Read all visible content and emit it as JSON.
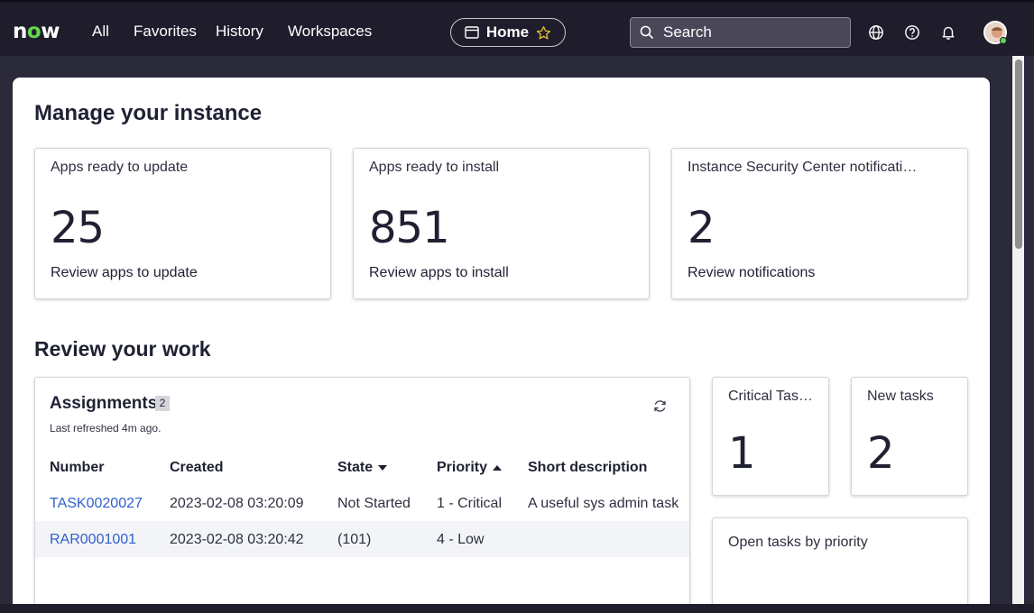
{
  "header": {
    "logo_text_n": "n",
    "logo_text_o": "o",
    "logo_text_w": "w",
    "nav": [
      "All",
      "Favorites",
      "History",
      "Workspaces"
    ],
    "home_label": "Home",
    "search_placeholder": "Search"
  },
  "page": {
    "section1_title": "Manage your instance",
    "section2_title": "Review your work"
  },
  "instance_cards": [
    {
      "title": "Apps ready to update",
      "value": "25",
      "link": "Review apps to update"
    },
    {
      "title": "Apps ready to install",
      "value": "851",
      "link": "Review apps to install"
    },
    {
      "title": "Instance Security Center notificati…",
      "value": "2",
      "link": "Review notifications"
    }
  ],
  "assignments": {
    "title": "Assignments",
    "count": "2",
    "refreshed": "Last refreshed 4m ago.",
    "columns": [
      "Number",
      "Created",
      "State",
      "Priority",
      "Short description"
    ],
    "rows": [
      {
        "number": "TASK0020027",
        "created": "2023-02-08 03:20:09",
        "state": "Not Started",
        "priority": "1 - Critical",
        "desc": "A useful sys admin task"
      },
      {
        "number": "RAR0001001",
        "created": "2023-02-08 03:20:42",
        "state": "(101)",
        "priority": "4 - Low",
        "desc": ""
      }
    ]
  },
  "side_cards": {
    "critical": {
      "title": "Critical Tas…",
      "value": "1"
    },
    "new": {
      "title": "New tasks",
      "value": "2"
    },
    "open_by_priority": {
      "title": "Open tasks by priority"
    }
  },
  "colors": {
    "header_bg": "#1f1d2c",
    "page_bg": "#2b2a3a",
    "link": "#2f5fcc",
    "logo_accent": "#62d84e",
    "star": "#e8c33a"
  }
}
